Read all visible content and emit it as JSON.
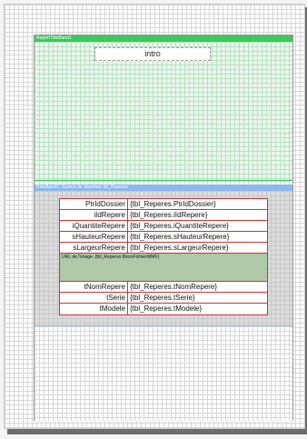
{
  "title_band": {
    "name": "ReportTitleBand1",
    "intro_label": "intro"
  },
  "data_band": {
    "name": "DataBand1, Source de données: tbl_Reperes",
    "rows_top": [
      {
        "label": "PtrIdDossier",
        "value": "{tbl_Reperes.PtrIdDossier}"
      },
      {
        "label": "iIdRepere",
        "value": "{tbl_Reperes.iIdRepere}"
      },
      {
        "label": "iQuantiteRepere",
        "value": "{tbl_Reperes.iQuantiteRepere}"
      },
      {
        "label": "sHauteurRepere",
        "value": "{tbl_Reperes.sHauteurRepere}"
      },
      {
        "label": "sLargeurRepere",
        "value": "{tbl_Reperes.sLargeurRepere}"
      }
    ],
    "image_caption": "URL de l'image: {tbl_Reperes.tNomFichierWMF}",
    "rows_bottom": [
      {
        "label": "tNomRepere",
        "value": "{tbl_Reperes.tNomRepere}"
      },
      {
        "label": "tSerie",
        "value": "{tbl_Reperes.tSerie}"
      },
      {
        "label": "tModele",
        "value": "{tbl_Reperes.tModele}"
      }
    ]
  },
  "colors": {
    "title_band": "#3cc85a",
    "data_band": "#8bb8f0",
    "field_border": "#d23030",
    "image_fill": "#aec8a8"
  }
}
